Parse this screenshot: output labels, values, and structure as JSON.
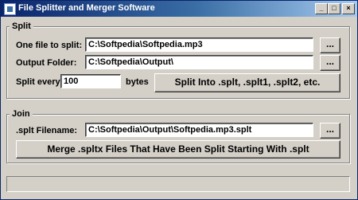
{
  "window": {
    "title": "File Splitter and Merger Software"
  },
  "split": {
    "group_label": "Split",
    "file_label": "One file to split:",
    "file_value": "C:\\Softpedia\\Softpedia.mp3",
    "browse_file_label": "...",
    "output_label": "Output Folder:",
    "output_value": "C:\\Softpedia\\Output\\",
    "browse_output_label": "...",
    "split_every_label": "Split every",
    "split_every_value": "100",
    "unit_label": "bytes",
    "split_button_label": "Split Into .splt, .splt1, .splt2, etc."
  },
  "join": {
    "group_label": "Join",
    "filename_label": ".splt Filename:",
    "filename_value": "C:\\Softpedia\\Output\\Softpedia.mp3.splt",
    "browse_label": "...",
    "merge_button_label": "Merge .spltx Files That Have Been Split Starting With .splt"
  },
  "status": {
    "text": ""
  }
}
